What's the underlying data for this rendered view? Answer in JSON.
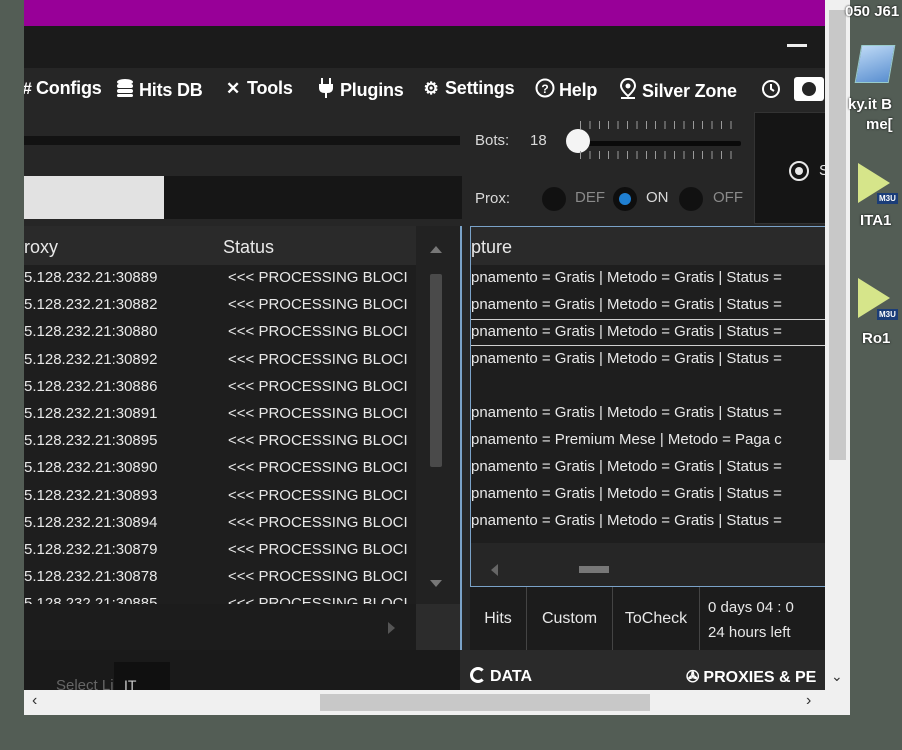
{
  "menu": {
    "items": [
      {
        "label": "Configs",
        "icon": "hash-icon"
      },
      {
        "label": "Hits DB",
        "icon": "database-icon"
      },
      {
        "label": "Tools",
        "icon": "tools-icon"
      },
      {
        "label": "Plugins",
        "icon": "plug-icon"
      },
      {
        "label": "Settings",
        "icon": "gear-icon"
      },
      {
        "label": "Help",
        "icon": "help-icon"
      },
      {
        "label": "Silver Zone",
        "icon": "location-pin-icon"
      }
    ]
  },
  "controls": {
    "bots_label": "Bots:",
    "bots_value": "18",
    "prox_label": "Prox:",
    "prox_options": [
      "DEF",
      "ON",
      "OFF"
    ],
    "prox_selected": "ON",
    "start_label": "S"
  },
  "proxy_table": {
    "headers": [
      "roxy",
      "Status"
    ],
    "rows": [
      [
        "5.128.232.21:30889",
        "<<< PROCESSING BLOCI"
      ],
      [
        "5.128.232.21:30882",
        "<<< PROCESSING BLOCI"
      ],
      [
        "5.128.232.21:30880",
        "<<< PROCESSING BLOCI"
      ],
      [
        "5.128.232.21:30892",
        "<<< PROCESSING BLOCI"
      ],
      [
        "5.128.232.21:30886",
        "<<< PROCESSING BLOCI"
      ],
      [
        "5.128.232.21:30891",
        "<<< PROCESSING BLOCI"
      ],
      [
        "5.128.232.21:30895",
        "<<< PROCESSING BLOCI"
      ],
      [
        "5.128.232.21:30890",
        "<<< PROCESSING BLOCI"
      ],
      [
        "5.128.232.21:30893",
        "<<< PROCESSING BLOCI"
      ],
      [
        "5.128.232.21:30894",
        "<<< PROCESSING BLOCI"
      ],
      [
        "5.128.232.21:30879",
        "<<< PROCESSING BLOCI"
      ],
      [
        "5.128.232.21:30878",
        "<<< PROCESSING BLOCI"
      ],
      [
        "5.128.232.21:30885",
        "<<< PROCESSING BLOCI"
      ]
    ]
  },
  "capture_table": {
    "header": "pture",
    "rows": [
      "pnamento = Gratis | Metodo = Gratis | Status =",
      "pnamento = Gratis | Metodo = Gratis | Status =",
      "pnamento = Gratis | Metodo = Gratis | Status =",
      "pnamento = Gratis | Metodo = Gratis | Status =",
      "",
      "pnamento = Gratis | Metodo = Gratis | Status =",
      "pnamento = Premium Mese | Metodo = Paga c",
      "pnamento = Gratis | Metodo = Gratis | Status =",
      "pnamento = Gratis | Metodo = Gratis | Status =",
      "pnamento = Gratis | Metodo = Gratis | Status ="
    ],
    "selected_row": 2
  },
  "tabs": [
    "Hits",
    "Custom",
    "ToCheck"
  ],
  "timer": {
    "line1": "0  days  04 : 0",
    "line2": "24 hours left"
  },
  "bottom": {
    "select_list": "Select List",
    "list_button": "IT",
    "data_label": "DATA",
    "proxies_label": "PROXIES & PE"
  },
  "desktop": {
    "top_text": "050 J61",
    "icon1_line1": "ky.it B",
    "icon1_line2": "me[",
    "icon2_label": "ITA1",
    "icon3_label": "Ro1",
    "m3u_badge": "M3U"
  }
}
